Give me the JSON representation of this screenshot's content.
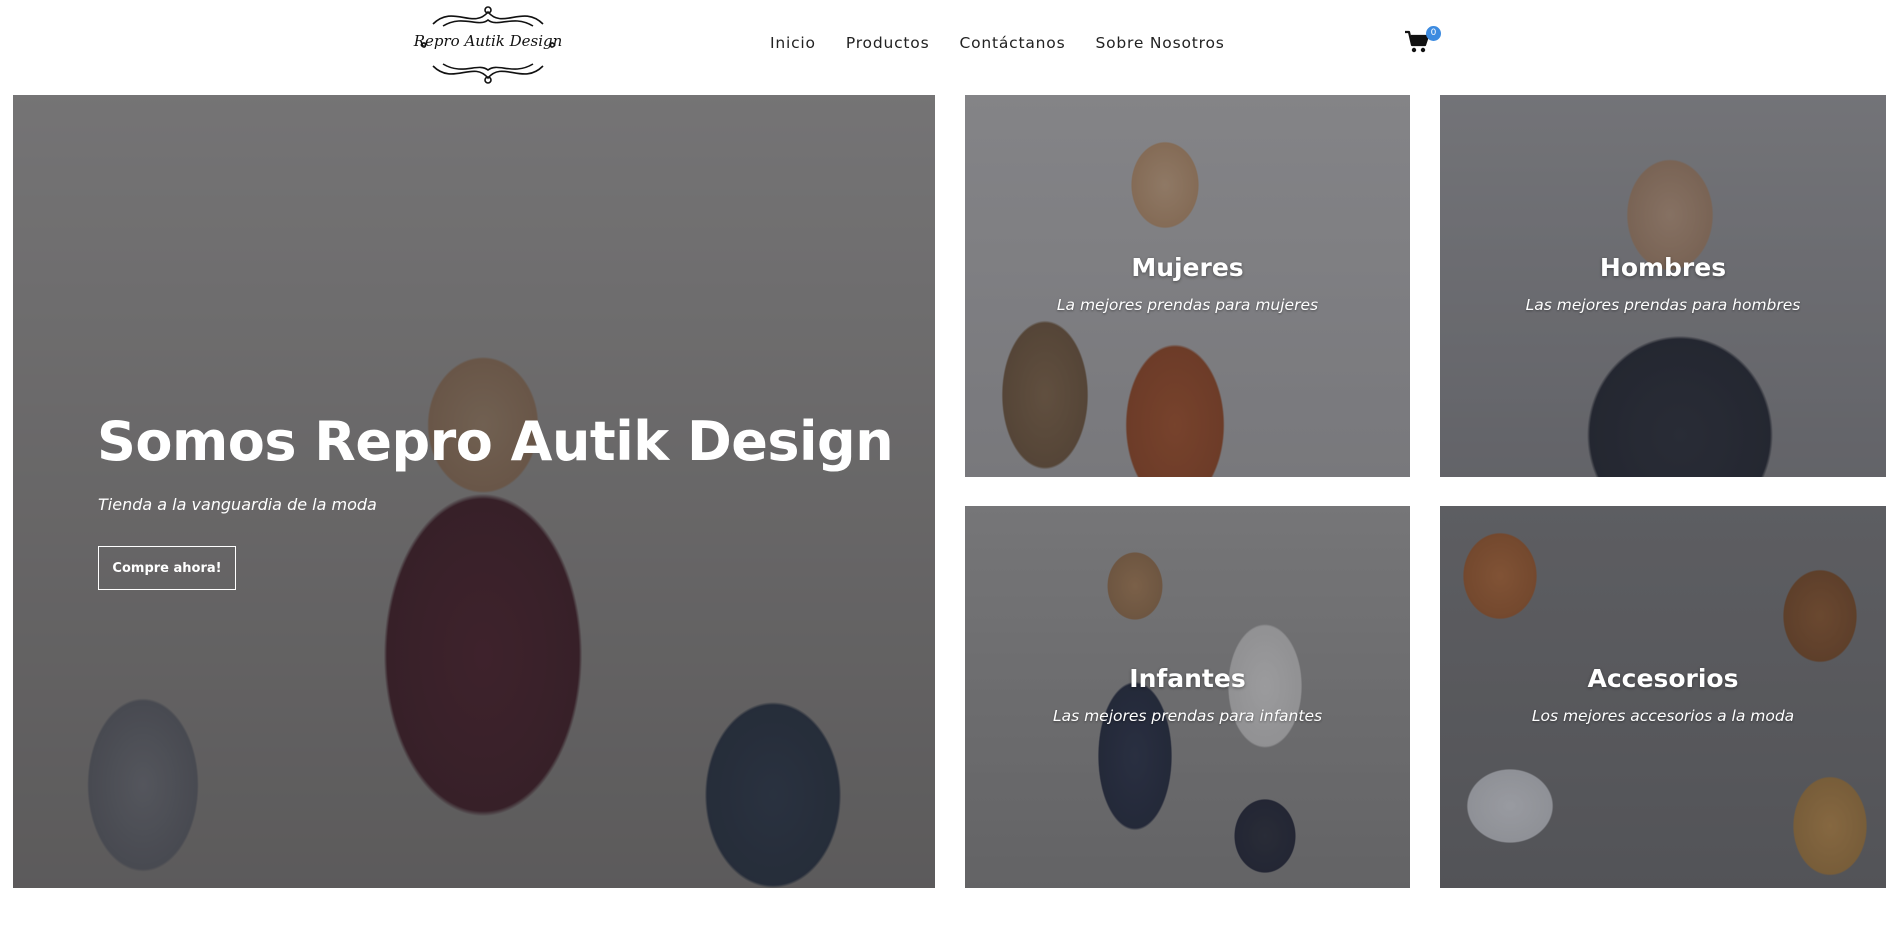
{
  "header": {
    "logo_text": "Repro Autik Design",
    "nav": [
      "Inicio",
      "Productos",
      "Contáctanos",
      "Sobre Nosotros"
    ],
    "cart": {
      "icon": "shopping-cart-icon",
      "count": "0"
    }
  },
  "hero": {
    "title": "Somos Repro Autik Design",
    "subtitle": "Tienda a la vanguardia de la moda",
    "button": "Compre ahora!"
  },
  "categories": [
    {
      "title": "Mujeres",
      "subtitle": "La mejores prendas para mujeres"
    },
    {
      "title": "Hombres",
      "subtitle": "Las mejores prendas para hombres"
    },
    {
      "title": "Infantes",
      "subtitle": "Las mejores prendas para infantes"
    },
    {
      "title": "Accesorios",
      "subtitle": "Los mejores accesorios a la moda"
    }
  ],
  "colors": {
    "badge": "#3d8be0",
    "overlay": "#28282d"
  }
}
